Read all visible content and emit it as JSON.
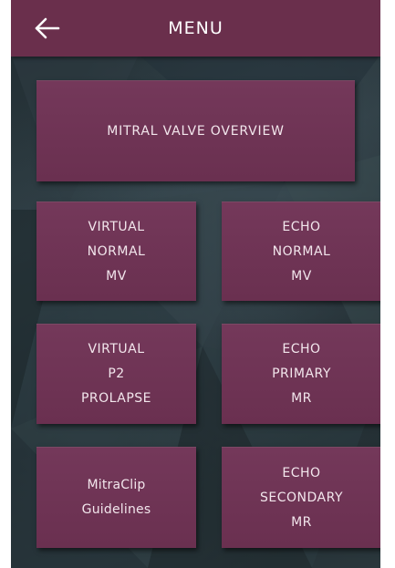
{
  "header": {
    "title": "MENU",
    "back_icon": "arrow-left-icon"
  },
  "colors": {
    "header_bg": "#6a2f4c",
    "tile_bg": "#70345a",
    "tile_text": "#f2e6ec",
    "background": "#243035"
  },
  "menu": {
    "overview": "MITRAL VALVE OVERVIEW",
    "virtual_normal": "VIRTUAL\nNORMAL\nMV",
    "echo_normal": "ECHO\nNORMAL\nMV",
    "virtual_prolapse": "VIRTUAL\nP2\nPROLAPSE",
    "echo_primary": "ECHO\nPRIMARY\nMR",
    "mitraclip": "MitraClip\nGuidelines",
    "echo_secondary": "ECHO\nSECONDARY\nMR"
  }
}
